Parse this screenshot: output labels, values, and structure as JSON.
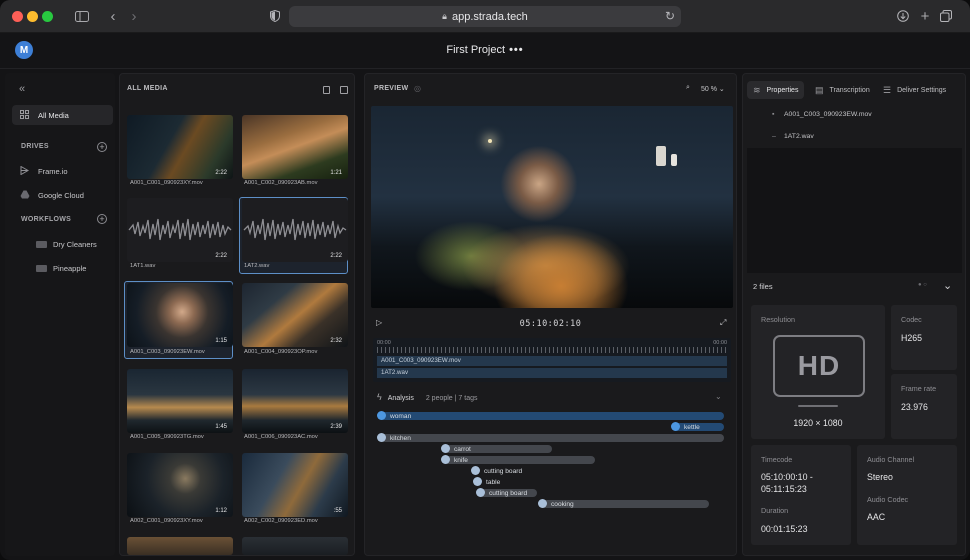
{
  "browser": {
    "url": "app.strada.tech"
  },
  "header": {
    "avatar": "M",
    "project_title": "First Project",
    "more": "•••"
  },
  "sidebar": {
    "all_media": "All Media",
    "drives_label": "DRIVES",
    "drives": [
      "Frame.io",
      "Google Cloud"
    ],
    "workflows_label": "WORKFLOWS",
    "workflows": [
      "Dry Cleaners",
      "Pineapple"
    ]
  },
  "media": {
    "title": "ALL MEDIA",
    "items": [
      {
        "name": "A001_C001_090923XY.mov",
        "duration": "2:22"
      },
      {
        "name": "A001_C002_090923AB.mov",
        "duration": "1:21"
      },
      {
        "name": "1AT1.wav",
        "duration": "2:22"
      },
      {
        "name": "1AT2.wav",
        "duration": "2:22"
      },
      {
        "name": "A001_C003_090923EW.mov",
        "duration": "1:15"
      },
      {
        "name": "A001_C004_090923OP.mov",
        "duration": "2:32"
      },
      {
        "name": "A001_C005_090923TG.mov",
        "duration": "1:45"
      },
      {
        "name": "A001_C006_090923AC.mov",
        "duration": "2:39"
      },
      {
        "name": "A002_C001_090923XY.mov",
        "duration": "1:12"
      },
      {
        "name": "A002_C002_090923ED.mov",
        "duration": ":55"
      }
    ]
  },
  "preview": {
    "title": "PREVIEW",
    "zoom": "50 %",
    "timecode": "05:10:02:10",
    "timeline_start": "00:00",
    "timeline_end": "00:00",
    "clips": [
      "A001_C003_090923EW.mov",
      "1AT2.wav"
    ]
  },
  "analysis": {
    "label": "Analysis",
    "meta": "2 people | 7 tags",
    "tags": [
      {
        "label": "woman",
        "style": "blue"
      },
      {
        "label": "kettle",
        "style": "blue"
      },
      {
        "label": "kitchen",
        "style": "grey"
      },
      {
        "label": "carrot",
        "style": "grey"
      },
      {
        "label": "knife",
        "style": "grey"
      },
      {
        "label": "cutting board",
        "style": "plain"
      },
      {
        "label": "table",
        "style": "plain"
      },
      {
        "label": "cutting board",
        "style": "grey"
      },
      {
        "label": "cooking",
        "style": "grey"
      }
    ]
  },
  "properties": {
    "tabs": [
      "Properties",
      "Transcription",
      "Deliver Settings"
    ],
    "files": [
      "A001_C003_090923EW.mov",
      "1AT2.wav"
    ],
    "files_count": "2 files",
    "resolution_label": "Resolution",
    "resolution_logo": "HD",
    "resolution": "1920 × 1080",
    "codec_label": "Codec",
    "codec": "H265",
    "framerate_label": "Frame rate",
    "framerate": "23.976",
    "timecode_label": "Timecode",
    "timecode": "05:10:00:10 -\n05:11:15:23",
    "audio_channel_label": "Audio Channel",
    "audio_channel": "Stereo",
    "audio_codec_label": "Audio Codec",
    "audio_codec": "AAC",
    "duration_label": "Duration",
    "duration": "00:01:15:23"
  }
}
